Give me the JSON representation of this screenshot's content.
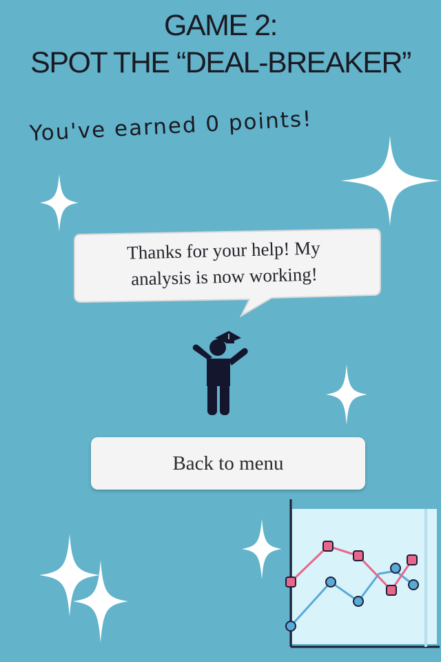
{
  "header": {
    "title_line1": "GAME 2:",
    "title_line2": "SPOT THE “DEAL-BREAKER”"
  },
  "score_text": "You've earned 0 points!",
  "speech_bubble": {
    "line1": "Thanks for your help! My",
    "line2": "analysis is now working!"
  },
  "menu": {
    "back_label": "Back to menu"
  },
  "colors": {
    "background": "#63b3cb",
    "bubble": "#f4f4f4",
    "person": "#14162e",
    "chart_pink": "#e8668a",
    "chart_blue": "#5aa9d6"
  },
  "icons": {
    "character": "cheering-person-icon",
    "chart": "line-chart-icon",
    "sparkles": "sparkle-icon"
  }
}
